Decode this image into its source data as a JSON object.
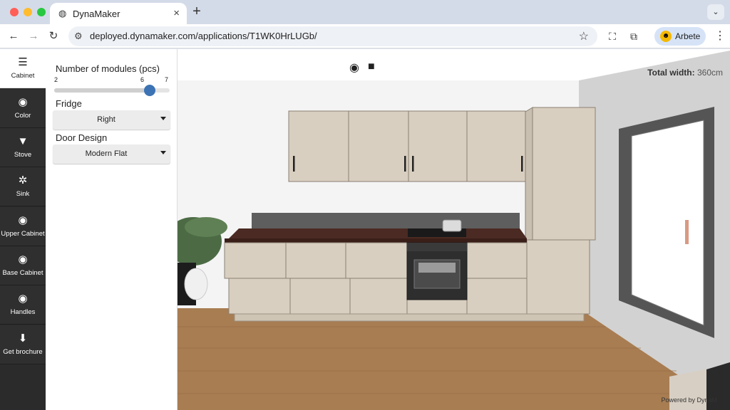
{
  "browser": {
    "tab_title": "DynaMaker",
    "url": "deployed.dynamaker.com/applications/T1WK0HrLUGb/",
    "profile_label": "Arbete",
    "icons": [
      "globe-icon",
      "close-icon",
      "plus-icon",
      "back-icon",
      "forward-icon",
      "reload-icon",
      "site-settings-icon",
      "star-icon",
      "screenshot-icon",
      "extensions-icon",
      "menu-dots-icon"
    ]
  },
  "sidebar": {
    "items": [
      {
        "label": "Cabinet",
        "icon": "cabinet-icon",
        "active": true
      },
      {
        "label": "Color",
        "icon": "eye-icon",
        "active": false
      },
      {
        "label": "Stove",
        "icon": "funnel-icon",
        "active": false
      },
      {
        "label": "Sink",
        "icon": "gear-icon",
        "active": false
      },
      {
        "label": "Upper Cabinet",
        "icon": "eye-icon",
        "active": false
      },
      {
        "label": "Base Cabinet",
        "icon": "eye-icon",
        "active": false
      },
      {
        "label": "Handles",
        "icon": "eye-icon",
        "active": false
      },
      {
        "label": "Get brochure",
        "icon": "download-icon",
        "active": false
      }
    ]
  },
  "panel": {
    "modules": {
      "label": "Number of modules (pcs)",
      "min": "2",
      "value": "6",
      "max": "7",
      "value_num": 6,
      "min_num": 2,
      "max_num": 7
    },
    "fridge": {
      "label": "Fridge",
      "value": "Right"
    },
    "door_design": {
      "label": "Door Design",
      "value": "Modern Flat"
    }
  },
  "viewport": {
    "total_width_label": "Total width:",
    "total_width_value": "360cm",
    "powered_by": "Powered by DynaM",
    "icons": [
      "eye-icon",
      "camera-icon"
    ]
  },
  "colors": {
    "sidebar_bg": "#2f2f2f",
    "accent": "#3c73b4",
    "cabinet": "#d9cfc0",
    "countertop": "#4a2a22",
    "floor": "#a87d52",
    "window_frame": "#555555"
  }
}
